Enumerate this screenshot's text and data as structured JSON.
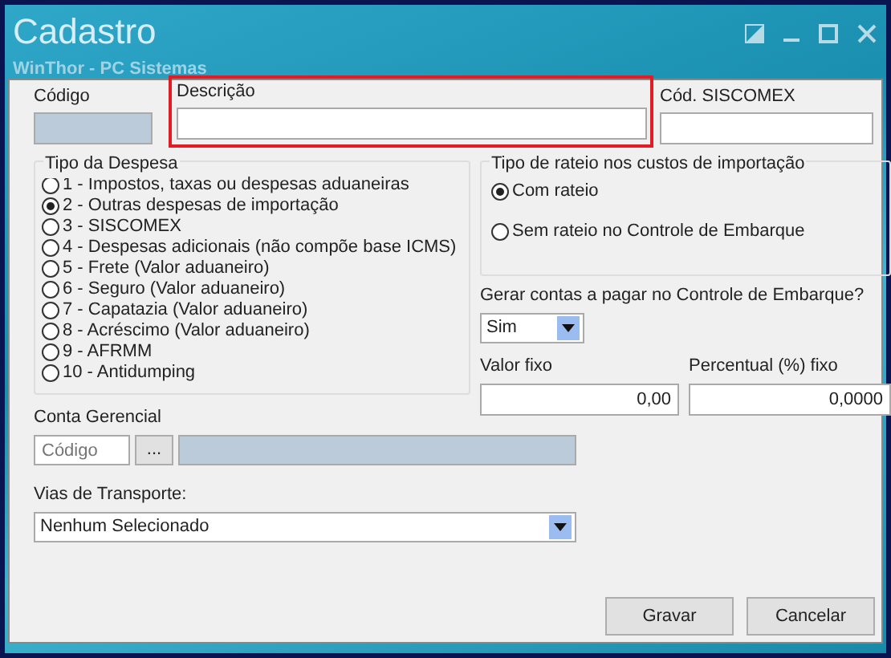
{
  "window": {
    "title": "Cadastro",
    "subtitle": "WinThor - PC Sistemas"
  },
  "top_fields": [
    {
      "label": "Código",
      "disabled": true,
      "highlighted": false
    },
    {
      "label": "Descrição",
      "disabled": false,
      "highlighted": true
    },
    {
      "label": "Cód. SISCOMEX",
      "disabled": false,
      "highlighted": false
    }
  ],
  "tipo_despesa": {
    "title": "Tipo da Despesa",
    "options": [
      {
        "label": "1 - Impostos, taxas ou despesas aduaneiras",
        "selected": false
      },
      {
        "label": "2 - Outras despesas de importação",
        "selected": true
      },
      {
        "label": "3 - SISCOMEX",
        "selected": false
      },
      {
        "label": "4 - Despesas adicionais (não compõe base ICMS)",
        "selected": false
      },
      {
        "label": "5 - Frete (Valor aduaneiro)",
        "selected": false
      },
      {
        "label": "6 - Seguro (Valor aduaneiro)",
        "selected": false
      },
      {
        "label": "7 - Capatazia (Valor aduaneiro)",
        "selected": false
      },
      {
        "label": "8 - Acréscimo (Valor aduaneiro)",
        "selected": false
      },
      {
        "label": "9 - AFRMM",
        "selected": false
      },
      {
        "label": "10 - Antidumping",
        "selected": false
      }
    ]
  },
  "tipo_rateio": {
    "title": "Tipo de rateio nos custos de importação",
    "options": [
      {
        "label": "Com rateio",
        "selected": true
      },
      {
        "label": "Sem rateio no Controle de Embarque",
        "selected": false
      }
    ]
  },
  "gerar_contas": {
    "label": "Gerar contas a pagar no Controle de Embarque?",
    "value": "Sim"
  },
  "valor_fixo": {
    "label": "Valor fixo",
    "value": "0,00"
  },
  "percentual_fixo": {
    "label": "Percentual (%) fixo",
    "value": "0,0000"
  },
  "conta_gerencial": {
    "label": "Conta Gerencial",
    "placeholder": "Código",
    "button": "..."
  },
  "vias_transporte": {
    "label": "Vias de Transporte:",
    "value": "Nenhum Selecionado"
  },
  "buttons": [
    "Gravar",
    "Cancelar"
  ]
}
